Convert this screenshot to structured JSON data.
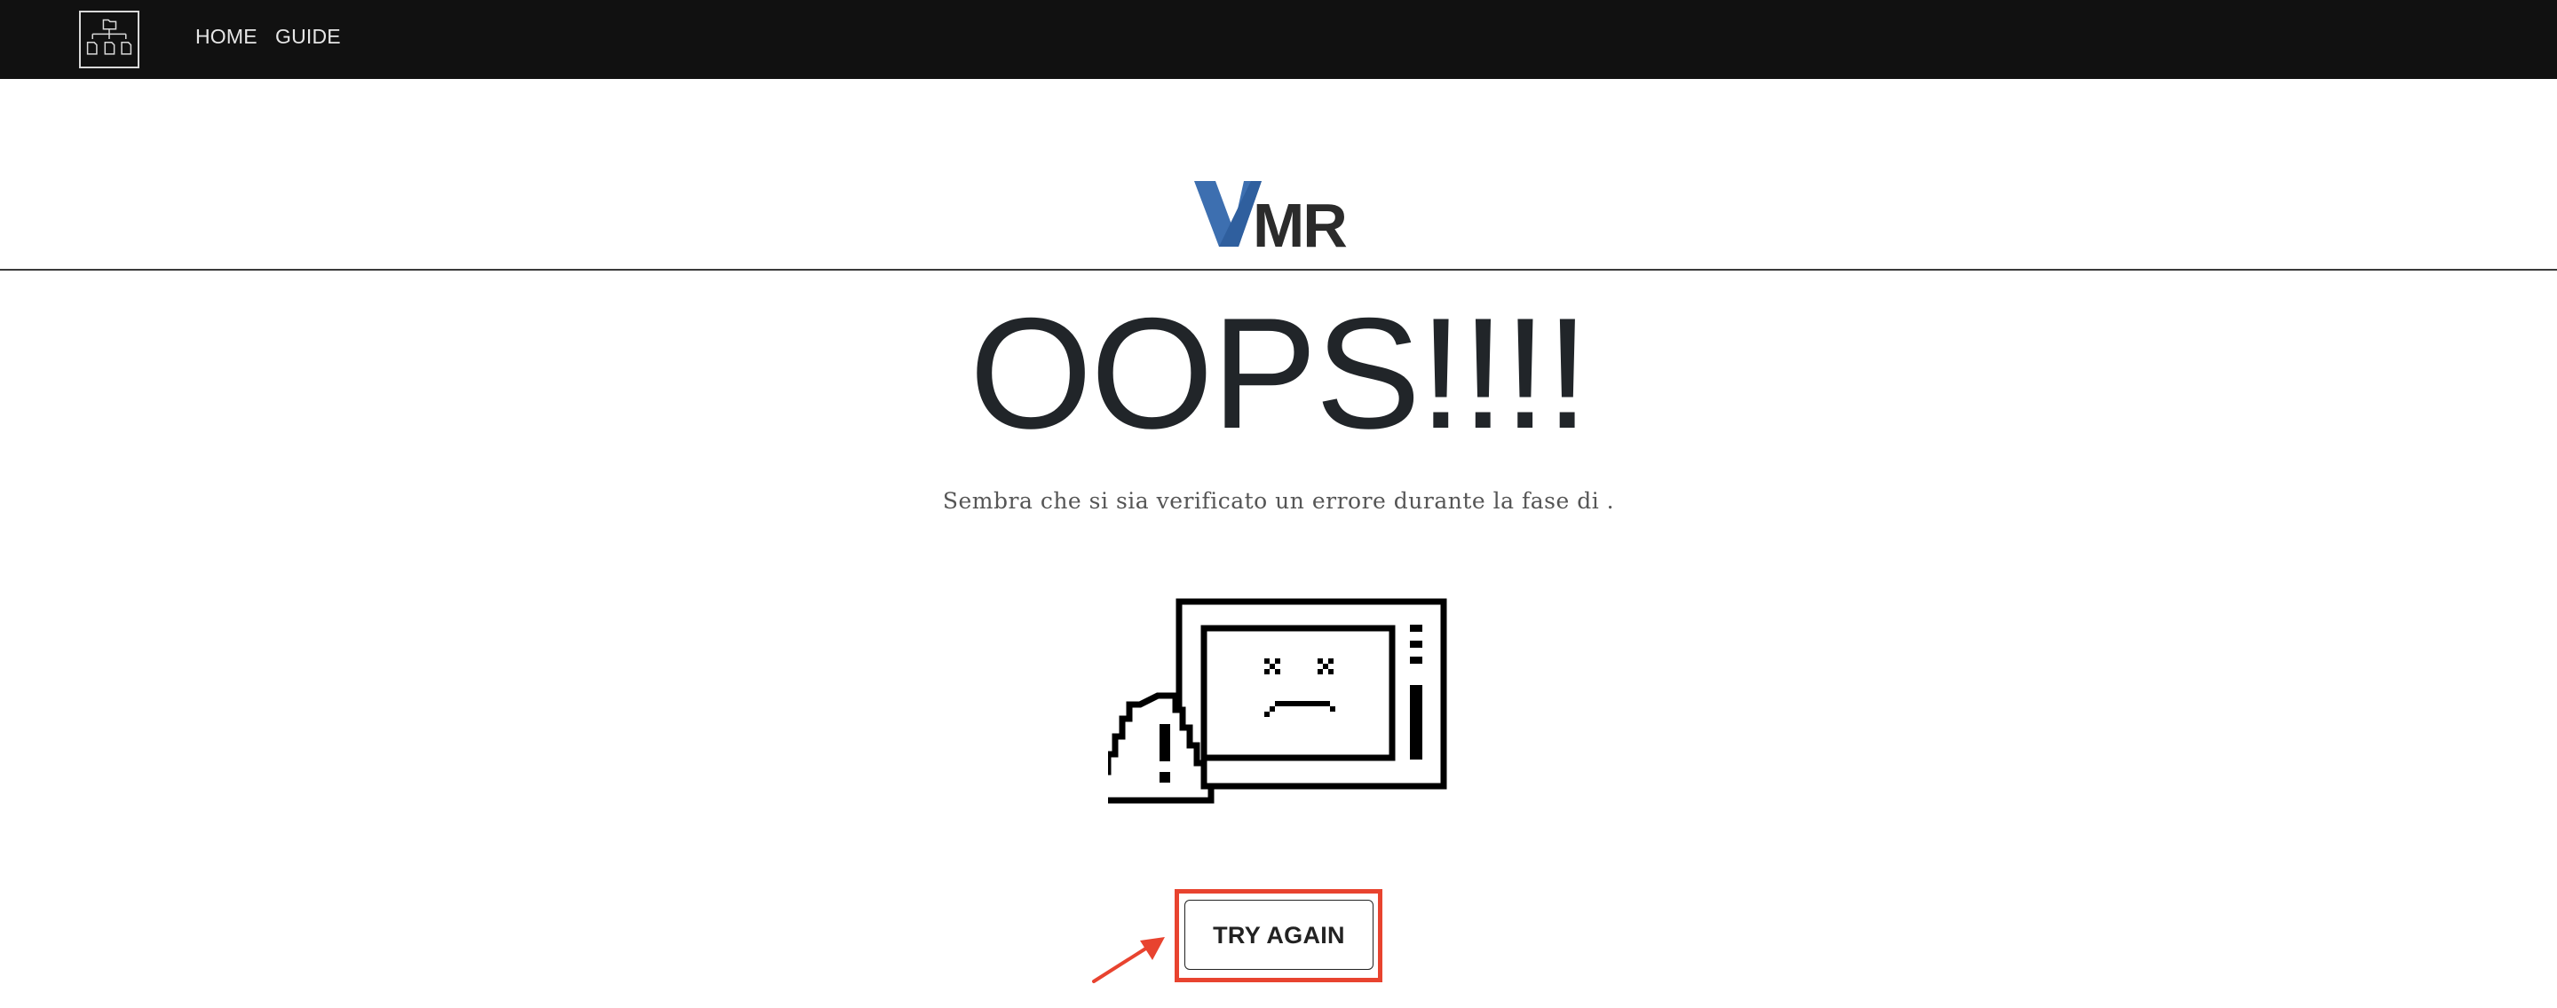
{
  "navbar": {
    "brand_icon": "folder-tree-icon",
    "links": [
      {
        "label": "HOME"
      },
      {
        "label": "GUIDE"
      }
    ]
  },
  "logo": {
    "text": "VMR",
    "colors": {
      "v": "#3d6fb0",
      "mr": "#2b2b2b"
    }
  },
  "error": {
    "title": "OOPS!!!!",
    "message": "Sembra che si sia verificato un errore durante la fase di .",
    "illustration": "broken-computer-warning-icon"
  },
  "actions": {
    "retry_label": "TRY AGAIN"
  },
  "annotation": {
    "highlight_color": "#e8432f",
    "pointer": "red-arrow-icon"
  }
}
